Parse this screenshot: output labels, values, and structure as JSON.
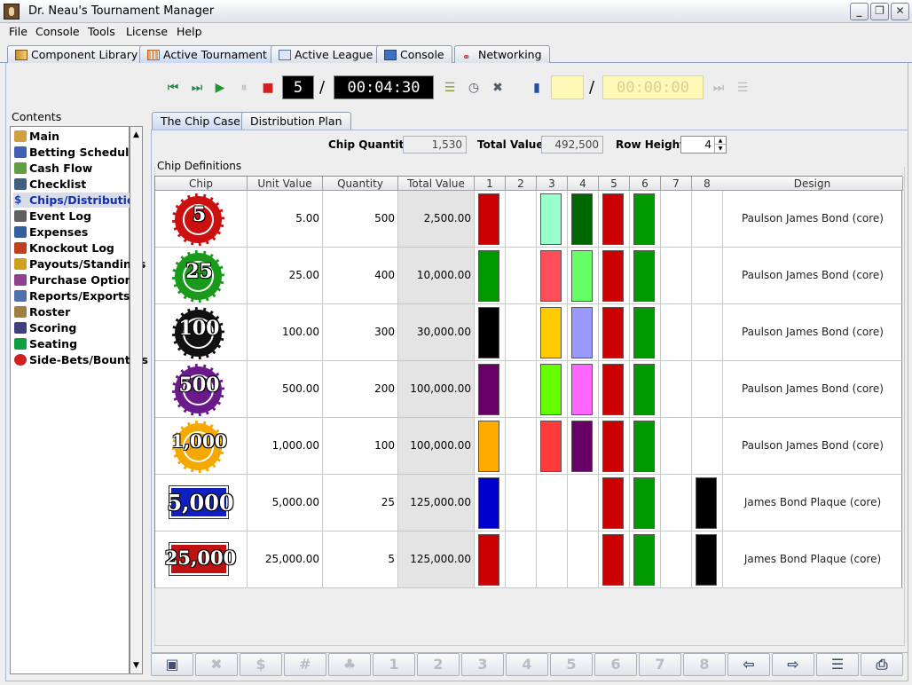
{
  "window": {
    "title": "Dr. Neau's Tournament Manager"
  },
  "menu": [
    "File",
    "Console",
    "Tools",
    "License",
    "Help"
  ],
  "main_tabs": [
    {
      "label": "Component Library",
      "icon": "book-icon"
    },
    {
      "label": "Active Tournament",
      "icon": "grid-icon",
      "active": true
    },
    {
      "label": "Active League",
      "icon": "league-icon"
    },
    {
      "label": "Console",
      "icon": "monitor-icon"
    },
    {
      "label": "Networking",
      "icon": "network-icon"
    }
  ],
  "toolbar": {
    "level": "5",
    "clock": "00:04:30",
    "clock2": "00:00:00",
    "level2": ""
  },
  "sidebar": {
    "label": "Contents",
    "items": [
      "Main",
      "Betting Schedule",
      "Cash Flow",
      "Checklist",
      "Chips/Distribution",
      "Event Log",
      "Expenses",
      "Knockout Log",
      "Payouts/Standings",
      "Purchase Options",
      "Reports/Exports",
      "Roster",
      "Scoring",
      "Seating",
      "Side-Bets/Bounties"
    ],
    "selected": "Chips/Distribution"
  },
  "sub_tabs": [
    {
      "label": "The Chip Case",
      "active": true
    },
    {
      "label": "Distribution Plan"
    }
  ],
  "summary": {
    "chip_quantity_label": "Chip Quantity:",
    "chip_quantity": "1,530",
    "total_value_label": "Total Value:",
    "total_value": "492,500",
    "row_height_label": "Row Height:",
    "row_height": "4"
  },
  "chip_definitions_label": "Chip Definitions",
  "table": {
    "headers": [
      "Chip",
      "Unit Value",
      "Quantity",
      "Total Value",
      "1",
      "2",
      "3",
      "4",
      "5",
      "6",
      "7",
      "8",
      "Design"
    ],
    "rows": [
      {
        "chip_label": "5",
        "chip_color": "#cc1010",
        "shape": "round",
        "unit": "5.00",
        "qty": "500",
        "total": "2,500.00",
        "swatches": [
          "#cc0000",
          null,
          "#99ffcc",
          "#006600",
          "#cc0000",
          "#009900",
          null,
          null
        ],
        "design": "Paulson James Bond (core)"
      },
      {
        "chip_label": "25",
        "chip_color": "#1a9a1a",
        "shape": "round",
        "unit": "25.00",
        "qty": "400",
        "total": "10,000.00",
        "swatches": [
          "#009900",
          null,
          "#ff4d5a",
          "#66ff66",
          "#cc0000",
          "#009900",
          null,
          null
        ],
        "design": "Paulson James Bond (core)"
      },
      {
        "chip_label": "100",
        "chip_color": "#111111",
        "shape": "round",
        "unit": "100.00",
        "qty": "300",
        "total": "30,000.00",
        "swatches": [
          "#000000",
          null,
          "#ffcc00",
          "#9999ff",
          "#cc0000",
          "#009900",
          null,
          null
        ],
        "design": "Paulson James Bond (core)"
      },
      {
        "chip_label": "500",
        "chip_color": "#6a1a8a",
        "shape": "round",
        "unit": "500.00",
        "qty": "200",
        "total": "100,000.00",
        "swatches": [
          "#660066",
          null,
          "#66ff00",
          "#ff66ff",
          "#cc0000",
          "#009900",
          null,
          null
        ],
        "design": "Paulson James Bond (core)"
      },
      {
        "chip_label": "1,000",
        "chip_color": "#f5a800",
        "shape": "round",
        "unit": "1,000.00",
        "qty": "100",
        "total": "100,000.00",
        "swatches": [
          "#ffaa00",
          null,
          "#ff3b3b",
          "#660066",
          "#cc0000",
          "#009900",
          null,
          null
        ],
        "design": "Paulson James Bond (core)"
      },
      {
        "chip_label": "5,000",
        "chip_color": "#1020c0",
        "shape": "plaque",
        "unit": "5,000.00",
        "qty": "25",
        "total": "125,000.00",
        "swatches": [
          "#0000cc",
          null,
          null,
          null,
          "#cc0000",
          "#009900",
          null,
          "#000000"
        ],
        "design": "James Bond Plaque (core)"
      },
      {
        "chip_label": "25,000",
        "chip_color": "#c01010",
        "shape": "plaque",
        "unit": "25,000.00",
        "qty": "5",
        "total": "125,000.00",
        "swatches": [
          "#cc0000",
          null,
          null,
          null,
          "#cc0000",
          "#009900",
          null,
          "#000000"
        ],
        "design": "James Bond Plaque (core)"
      }
    ]
  },
  "bottom_buttons": [
    {
      "icon": "new-chip-icon",
      "glyph": "▣",
      "enabled": true
    },
    {
      "icon": "delete-icon",
      "glyph": "✖",
      "enabled": false
    },
    {
      "icon": "dollar-icon",
      "glyph": "$",
      "enabled": false
    },
    {
      "icon": "hash-icon",
      "glyph": "#",
      "enabled": false
    },
    {
      "icon": "chips-stack-icon",
      "glyph": "♣",
      "enabled": false
    },
    {
      "icon": "col1-icon",
      "glyph": "1",
      "enabled": false
    },
    {
      "icon": "col2-icon",
      "glyph": "2",
      "enabled": false
    },
    {
      "icon": "col3-icon",
      "glyph": "3",
      "enabled": false
    },
    {
      "icon": "col4-icon",
      "glyph": "4",
      "enabled": false
    },
    {
      "icon": "col5-icon",
      "glyph": "5",
      "enabled": false
    },
    {
      "icon": "col6-icon",
      "glyph": "6",
      "enabled": false
    },
    {
      "icon": "col7-icon",
      "glyph": "7",
      "enabled": false
    },
    {
      "icon": "col8-icon",
      "glyph": "8",
      "enabled": false
    },
    {
      "icon": "import-icon",
      "glyph": "⇦",
      "enabled": true
    },
    {
      "icon": "export-icon",
      "glyph": "⇨",
      "enabled": true
    },
    {
      "icon": "list-icon",
      "glyph": "☰",
      "enabled": true
    },
    {
      "icon": "print-icon",
      "glyph": "⎙",
      "enabled": true
    }
  ]
}
